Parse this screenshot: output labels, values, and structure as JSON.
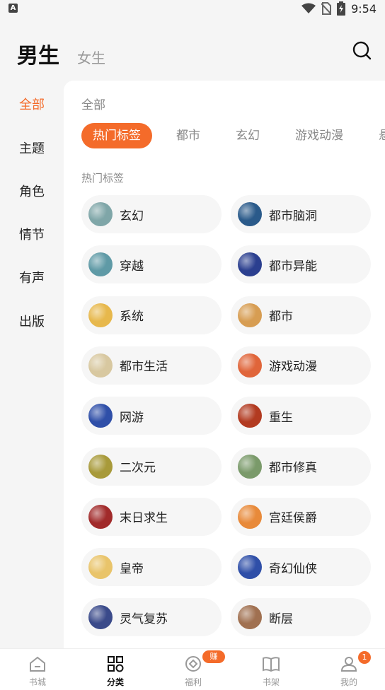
{
  "status_bar": {
    "time": "9:54",
    "app_icon_letter": "A"
  },
  "header": {
    "tab_male": "男生",
    "tab_female": "女生",
    "search_icon": "search-icon"
  },
  "sidebar": {
    "items": [
      {
        "label": "全部",
        "active": true
      },
      {
        "label": "主题"
      },
      {
        "label": "角色"
      },
      {
        "label": "情节"
      },
      {
        "label": "有声"
      },
      {
        "label": "出版"
      }
    ]
  },
  "panel": {
    "title": "全部",
    "chips": [
      {
        "label": "热门标签",
        "active": true
      },
      {
        "label": "都市"
      },
      {
        "label": "玄幻"
      },
      {
        "label": "游戏动漫"
      },
      {
        "label": "悬"
      }
    ],
    "section_label": "热门标签",
    "tags": [
      {
        "label": "玄幻",
        "color": "#7fa6a8"
      },
      {
        "label": "都市脑洞",
        "color": "#2a5a8a"
      },
      {
        "label": "穿越",
        "color": "#5f9aa6"
      },
      {
        "label": "都市异能",
        "color": "#2b3f8f"
      },
      {
        "label": "系统",
        "color": "#e7b84c"
      },
      {
        "label": "都市",
        "color": "#d79d52"
      },
      {
        "label": "都市生活",
        "color": "#d8c8a0"
      },
      {
        "label": "游戏动漫",
        "color": "#e0653a"
      },
      {
        "label": "网游",
        "color": "#2f4fa8"
      },
      {
        "label": "重生",
        "color": "#b23a20"
      },
      {
        "label": "二次元",
        "color": "#a89a3a"
      },
      {
        "label": "都市修真",
        "color": "#7a9a6a"
      },
      {
        "label": "末日求生",
        "color": "#a12a2a"
      },
      {
        "label": "宫廷侯爵",
        "color": "#e88a3a"
      },
      {
        "label": "皇帝",
        "color": "#e9c46a"
      },
      {
        "label": "奇幻仙侠",
        "color": "#2f4fa8"
      },
      {
        "label": "灵气复苏",
        "color": "#3a4a8a"
      },
      {
        "label": "断层",
        "color": "#a07050"
      }
    ]
  },
  "bottom_nav": [
    {
      "label": "书城",
      "icon": "home-icon"
    },
    {
      "label": "分类",
      "icon": "category-icon",
      "active": true
    },
    {
      "label": "福利",
      "icon": "coin-icon",
      "badge": "赚钱"
    },
    {
      "label": "书架",
      "icon": "bookshelf-icon"
    },
    {
      "label": "我的",
      "icon": "profile-icon",
      "badge": "1"
    }
  ],
  "colors": {
    "accent": "#f46b2a",
    "background": "#f5f5f5",
    "panel": "#ffffff",
    "tag_bg": "#f6f6f6"
  }
}
